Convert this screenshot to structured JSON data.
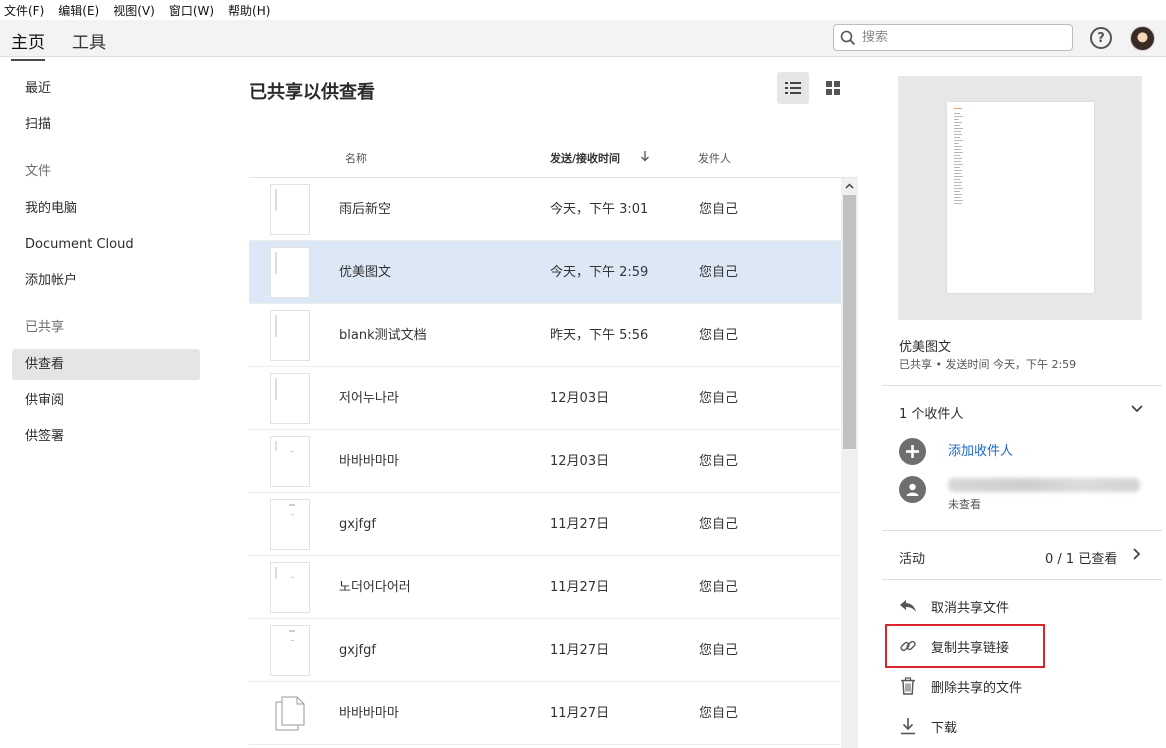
{
  "menu": [
    "文件(F)",
    "编辑(E)",
    "视图(V)",
    "窗口(W)",
    "帮助(H)"
  ],
  "nav": {
    "home": "主页",
    "tools": "工具"
  },
  "search": {
    "placeholder": "搜索"
  },
  "sidebar": {
    "recent": "最近",
    "scan": "扫描",
    "files_section": "文件",
    "my_computer": "我的电脑",
    "document_cloud": "Document Cloud",
    "add_account": "添加帐户",
    "shared_section": "已共享",
    "for_view": "供查看",
    "for_review": "供审阅",
    "for_sign": "供签署"
  },
  "main": {
    "title": "已共享以供查看",
    "columns": {
      "name": "名称",
      "time": "发送/接收时间",
      "sender": "发件人"
    },
    "rows": [
      {
        "name": "雨后新空",
        "time": "今天，下午 3:01",
        "sender": "您自己"
      },
      {
        "name": "优美图文",
        "time": "今天，下午 2:59",
        "sender": "您自己"
      },
      {
        "name": "blank测试文档",
        "time": "昨天，下午 5:56",
        "sender": "您自己"
      },
      {
        "name": "저어누나라",
        "time": "12月03日",
        "sender": "您自己"
      },
      {
        "name": "바바바마마",
        "time": "12月03日",
        "sender": "您自己"
      },
      {
        "name": "gxjfgf",
        "time": "11月27日",
        "sender": "您自己"
      },
      {
        "name": "노더어다어러",
        "time": "11月27日",
        "sender": "您自己"
      },
      {
        "name": "gxjfgf",
        "time": "11月27日",
        "sender": "您自己"
      },
      {
        "name": "바바바마마",
        "time": "11月27日",
        "sender": "您自己"
      }
    ]
  },
  "panel": {
    "doc_title": "优美图文",
    "doc_meta": "已共享 • 发送时间 今天，下午 2:59",
    "recipients_count": "1 个收件人",
    "add_recipient": "添加收件人",
    "recipient_status": "未查看",
    "activity_label": "活动",
    "activity_value": "0 / 1 已查看",
    "actions": {
      "unshare": "取消共享文件",
      "copy_link": "复制共享链接",
      "delete": "删除共享的文件",
      "download": "下载"
    }
  },
  "colors": {
    "selected_row": "#dde8f6",
    "link": "#1b68c6",
    "highlight": "#d9262d"
  }
}
